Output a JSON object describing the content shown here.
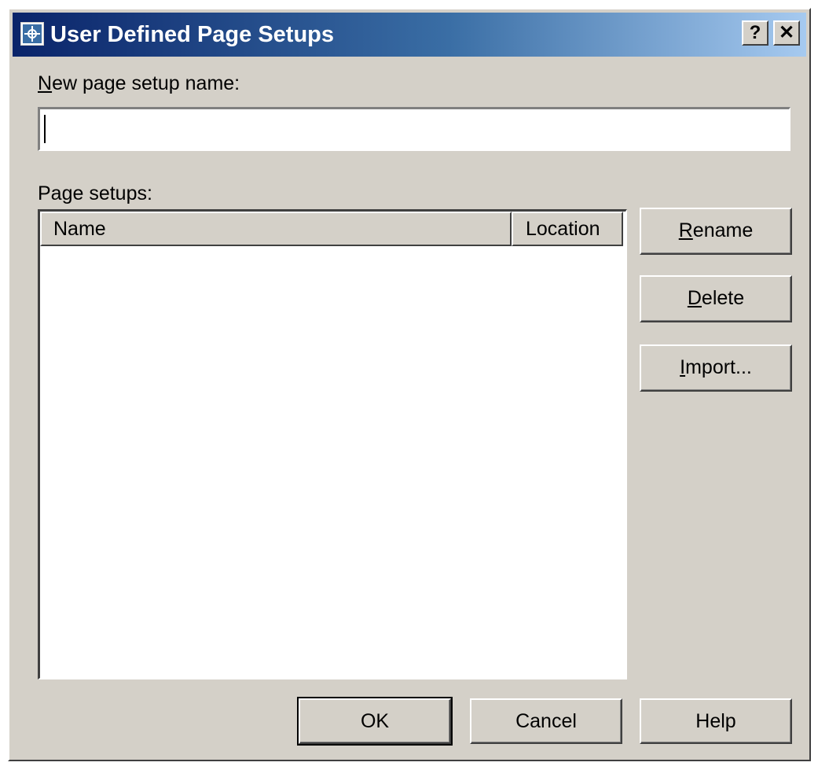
{
  "window": {
    "title": "User Defined Page Setups",
    "help_button": "?",
    "close_button": "✕"
  },
  "new_setup": {
    "label_hotkey": "N",
    "label_rest": "ew page setup name:",
    "value": ""
  },
  "page_setups": {
    "label": "Page setups:",
    "columns": [
      "Name",
      "Location"
    ],
    "rows": []
  },
  "buttons": {
    "rename_hotkey": "R",
    "rename_rest": "ename",
    "delete_hotkey": "D",
    "delete_rest": "elete",
    "import_hotkey": "I",
    "import_rest": "mport...",
    "ok": "OK",
    "cancel": "Cancel",
    "help": "Help"
  },
  "colors": {
    "dialog_bg": "#d4d0c8",
    "titlebar_start": "#0a246a",
    "titlebar_end": "#a6caf0"
  }
}
